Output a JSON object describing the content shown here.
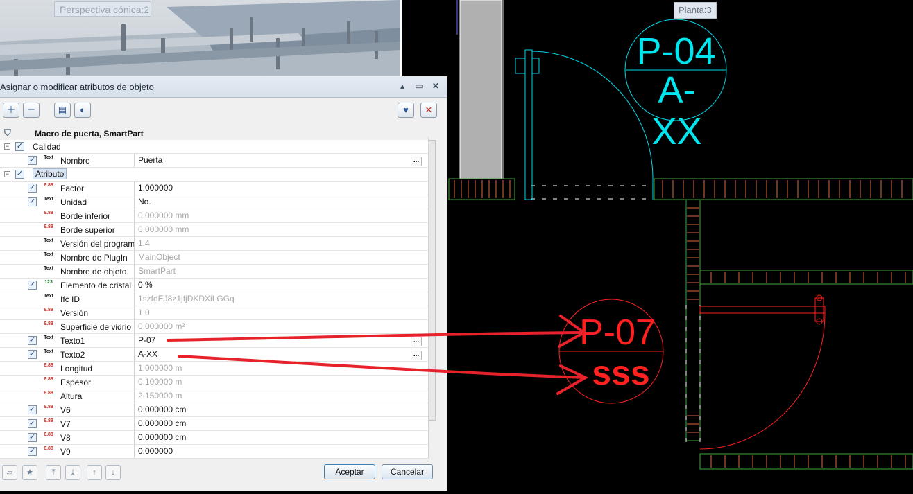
{
  "view3d": {
    "label": "Perspectiva cónica:2"
  },
  "cad": {
    "planta_label": "Planta:3",
    "tag_top": {
      "line1": "P-04",
      "line2": "A-XX",
      "color": "#00e5ee"
    },
    "tag_bottom": {
      "line1": "P-07",
      "line2": "sss",
      "color": "#ff2020"
    }
  },
  "dialog": {
    "title": "Asignar o modificar atributos de objeto",
    "window_controls": {
      "pin": "▴",
      "maximize": "▭",
      "close": "✕"
    },
    "toolbar": {
      "add_icon": "plus-icon",
      "remove_icon": "minus-icon",
      "props_icon": "properties-icon",
      "palette_icon": "palette-icon",
      "save_fav_icon": "favorite-add-icon",
      "delete_fav_icon": "favorite-delete-icon"
    },
    "object_name": "Macro de puerta, SmartPart",
    "groups": [
      {
        "name": "Calidad",
        "expanded": "−",
        "rows": [
          {
            "label": "Nombre",
            "value": "Puerta",
            "type": "text",
            "checked": true,
            "readonly": false,
            "dots": true
          }
        ]
      },
      {
        "name": "Atributo",
        "expanded": "−",
        "rows": [
          {
            "label": "Factor",
            "value": "1.000000",
            "type": "num",
            "checked": true,
            "readonly": false
          },
          {
            "label": "Unidad",
            "value": "No.",
            "type": "text",
            "checked": true,
            "readonly": false
          },
          {
            "label": "Borde inferior",
            "value": "0.000000 mm",
            "type": "num",
            "checked": false,
            "readonly": true
          },
          {
            "label": "Borde superior",
            "value": "0.000000 mm",
            "type": "num",
            "checked": false,
            "readonly": true
          },
          {
            "label": "Versión del program",
            "value": "1.4",
            "type": "text",
            "checked": false,
            "readonly": true
          },
          {
            "label": "Nombre de PlugIn",
            "value": "MainObject",
            "type": "text",
            "checked": false,
            "readonly": true
          },
          {
            "label": "Nombre de objeto",
            "value": "SmartPart",
            "type": "text",
            "checked": false,
            "readonly": true
          },
          {
            "label": "Elemento de cristal",
            "value": "0 %",
            "type": "int",
            "checked": true,
            "readonly": false
          },
          {
            "label": "Ifc ID",
            "value": "1szfdEJ8z1jfjDKDXiLGGq",
            "type": "text",
            "checked": false,
            "readonly": true
          },
          {
            "label": "Versión",
            "value": "1.0",
            "type": "num",
            "checked": false,
            "readonly": true
          },
          {
            "label": "Superficie de vidrio",
            "value": "0.000000 m²",
            "type": "num",
            "checked": false,
            "readonly": true
          },
          {
            "label": "Texto1",
            "value": "P-07",
            "type": "text",
            "checked": true,
            "readonly": false,
            "dots": true
          },
          {
            "label": "Texto2",
            "value": "A-XX",
            "type": "text",
            "checked": true,
            "readonly": false,
            "dots": true
          },
          {
            "label": "Longitud",
            "value": "1.000000 m",
            "type": "num",
            "checked": false,
            "readonly": true
          },
          {
            "label": "Espesor",
            "value": "0.100000 m",
            "type": "num",
            "checked": false,
            "readonly": true
          },
          {
            "label": "Altura",
            "value": "2.150000 m",
            "type": "num",
            "checked": false,
            "readonly": true
          },
          {
            "label": "V6",
            "value": "0.000000 cm",
            "type": "num",
            "checked": true,
            "readonly": false
          },
          {
            "label": "V7",
            "value": "0.000000 cm",
            "type": "num",
            "checked": true,
            "readonly": false
          },
          {
            "label": "V8",
            "value": "0.000000 cm",
            "type": "num",
            "checked": true,
            "readonly": false
          },
          {
            "label": "V9",
            "value": "0.000000",
            "type": "num",
            "checked": true,
            "readonly": false
          }
        ]
      }
    ],
    "type_icon_text": {
      "text": "Text",
      "num": "6.88",
      "int": "123"
    },
    "ellipsis": "...",
    "check": "✓",
    "footer": {
      "accept": "Aceptar",
      "cancel": "Cancelar",
      "open_icon": "folder-open-icon",
      "fav_icon": "favorites-icon",
      "up_all_icon": "move-top-icon",
      "down_all_icon": "move-bottom-icon",
      "up_icon": "move-up-icon",
      "down_icon": "move-down-icon"
    }
  }
}
